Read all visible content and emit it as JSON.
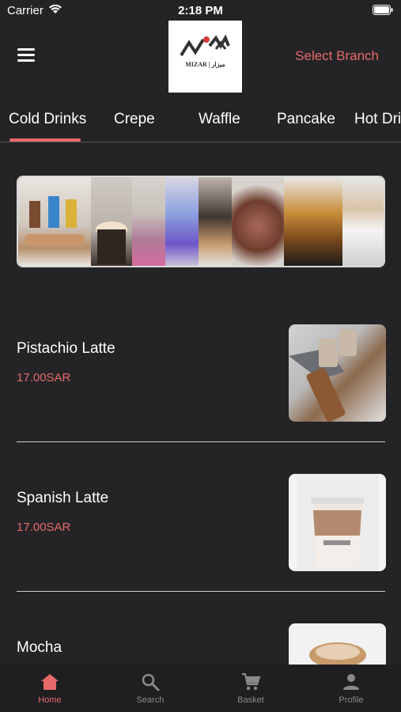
{
  "status_bar": {
    "carrier": "Carrier",
    "time": "2:18 PM"
  },
  "header": {
    "logo_text": "MIZAR | ميزار",
    "select_branch": "Select Branch"
  },
  "tabs": [
    {
      "label": "Cold Drinks",
      "active": true
    },
    {
      "label": "Crepe",
      "active": false
    },
    {
      "label": "Waffle",
      "active": false
    },
    {
      "label": "Pancake",
      "active": false
    },
    {
      "label": "Hot Dri",
      "active": false
    }
  ],
  "products": [
    {
      "name": "Pistachio Latte",
      "price": "17.00SAR"
    },
    {
      "name": "Spanish Latte",
      "price": "17.00SAR"
    },
    {
      "name": "Mocha",
      "price": ""
    }
  ],
  "bottom_nav": [
    {
      "label": "Home",
      "icon": "home-icon",
      "active": true
    },
    {
      "label": "Search",
      "icon": "search-icon",
      "active": false
    },
    {
      "label": "Basket",
      "icon": "cart-icon",
      "active": false
    },
    {
      "label": "Profile",
      "icon": "person-icon",
      "active": false
    }
  ],
  "colors": {
    "background": "#242427",
    "accent": "#e66a6a",
    "nav_background": "#1f1f22"
  }
}
